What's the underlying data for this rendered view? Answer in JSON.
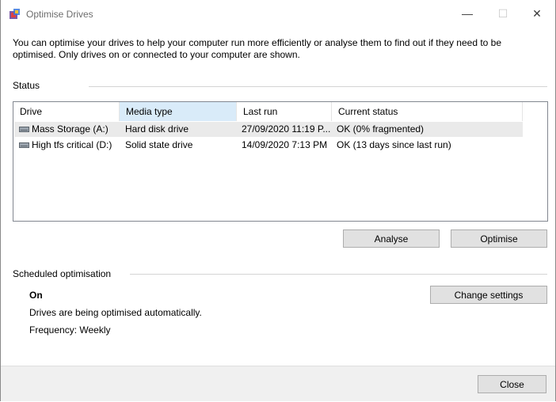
{
  "window": {
    "title": "Optimise Drives",
    "minimize_glyph": "—",
    "maximize_glyph": "☐",
    "close_glyph": "✕"
  },
  "intro_text": "You can optimise your drives to help your computer run more efficiently or analyse them to find out if they need to be optimised. Only drives on or connected to your computer are shown.",
  "status": {
    "label": "Status",
    "columns": [
      "Drive",
      "Media type",
      "Last run",
      "Current status"
    ],
    "rows": [
      {
        "drive": "Mass Storage (A:)",
        "media_type": "Hard disk drive",
        "last_run": "27/09/2020 11:19 P...",
        "current_status": "OK (0% fragmented)"
      },
      {
        "drive": "High tfs critical (D:)",
        "media_type": "Solid state drive",
        "last_run": "14/09/2020 7:13 PM",
        "current_status": "OK (13 days since last run)"
      }
    ],
    "analyse_label": "Analyse",
    "optimise_label": "Optimise"
  },
  "scheduled": {
    "label": "Scheduled optimisation",
    "state": "On",
    "description": "Drives are being optimised automatically.",
    "frequency": "Frequency: Weekly",
    "change_settings_label": "Change settings"
  },
  "footer": {
    "close_label": "Close"
  },
  "colors": {
    "header_selected": "#d9ebf9",
    "row_selected": "#eaeaea",
    "button_bg": "#e1e1e1"
  }
}
